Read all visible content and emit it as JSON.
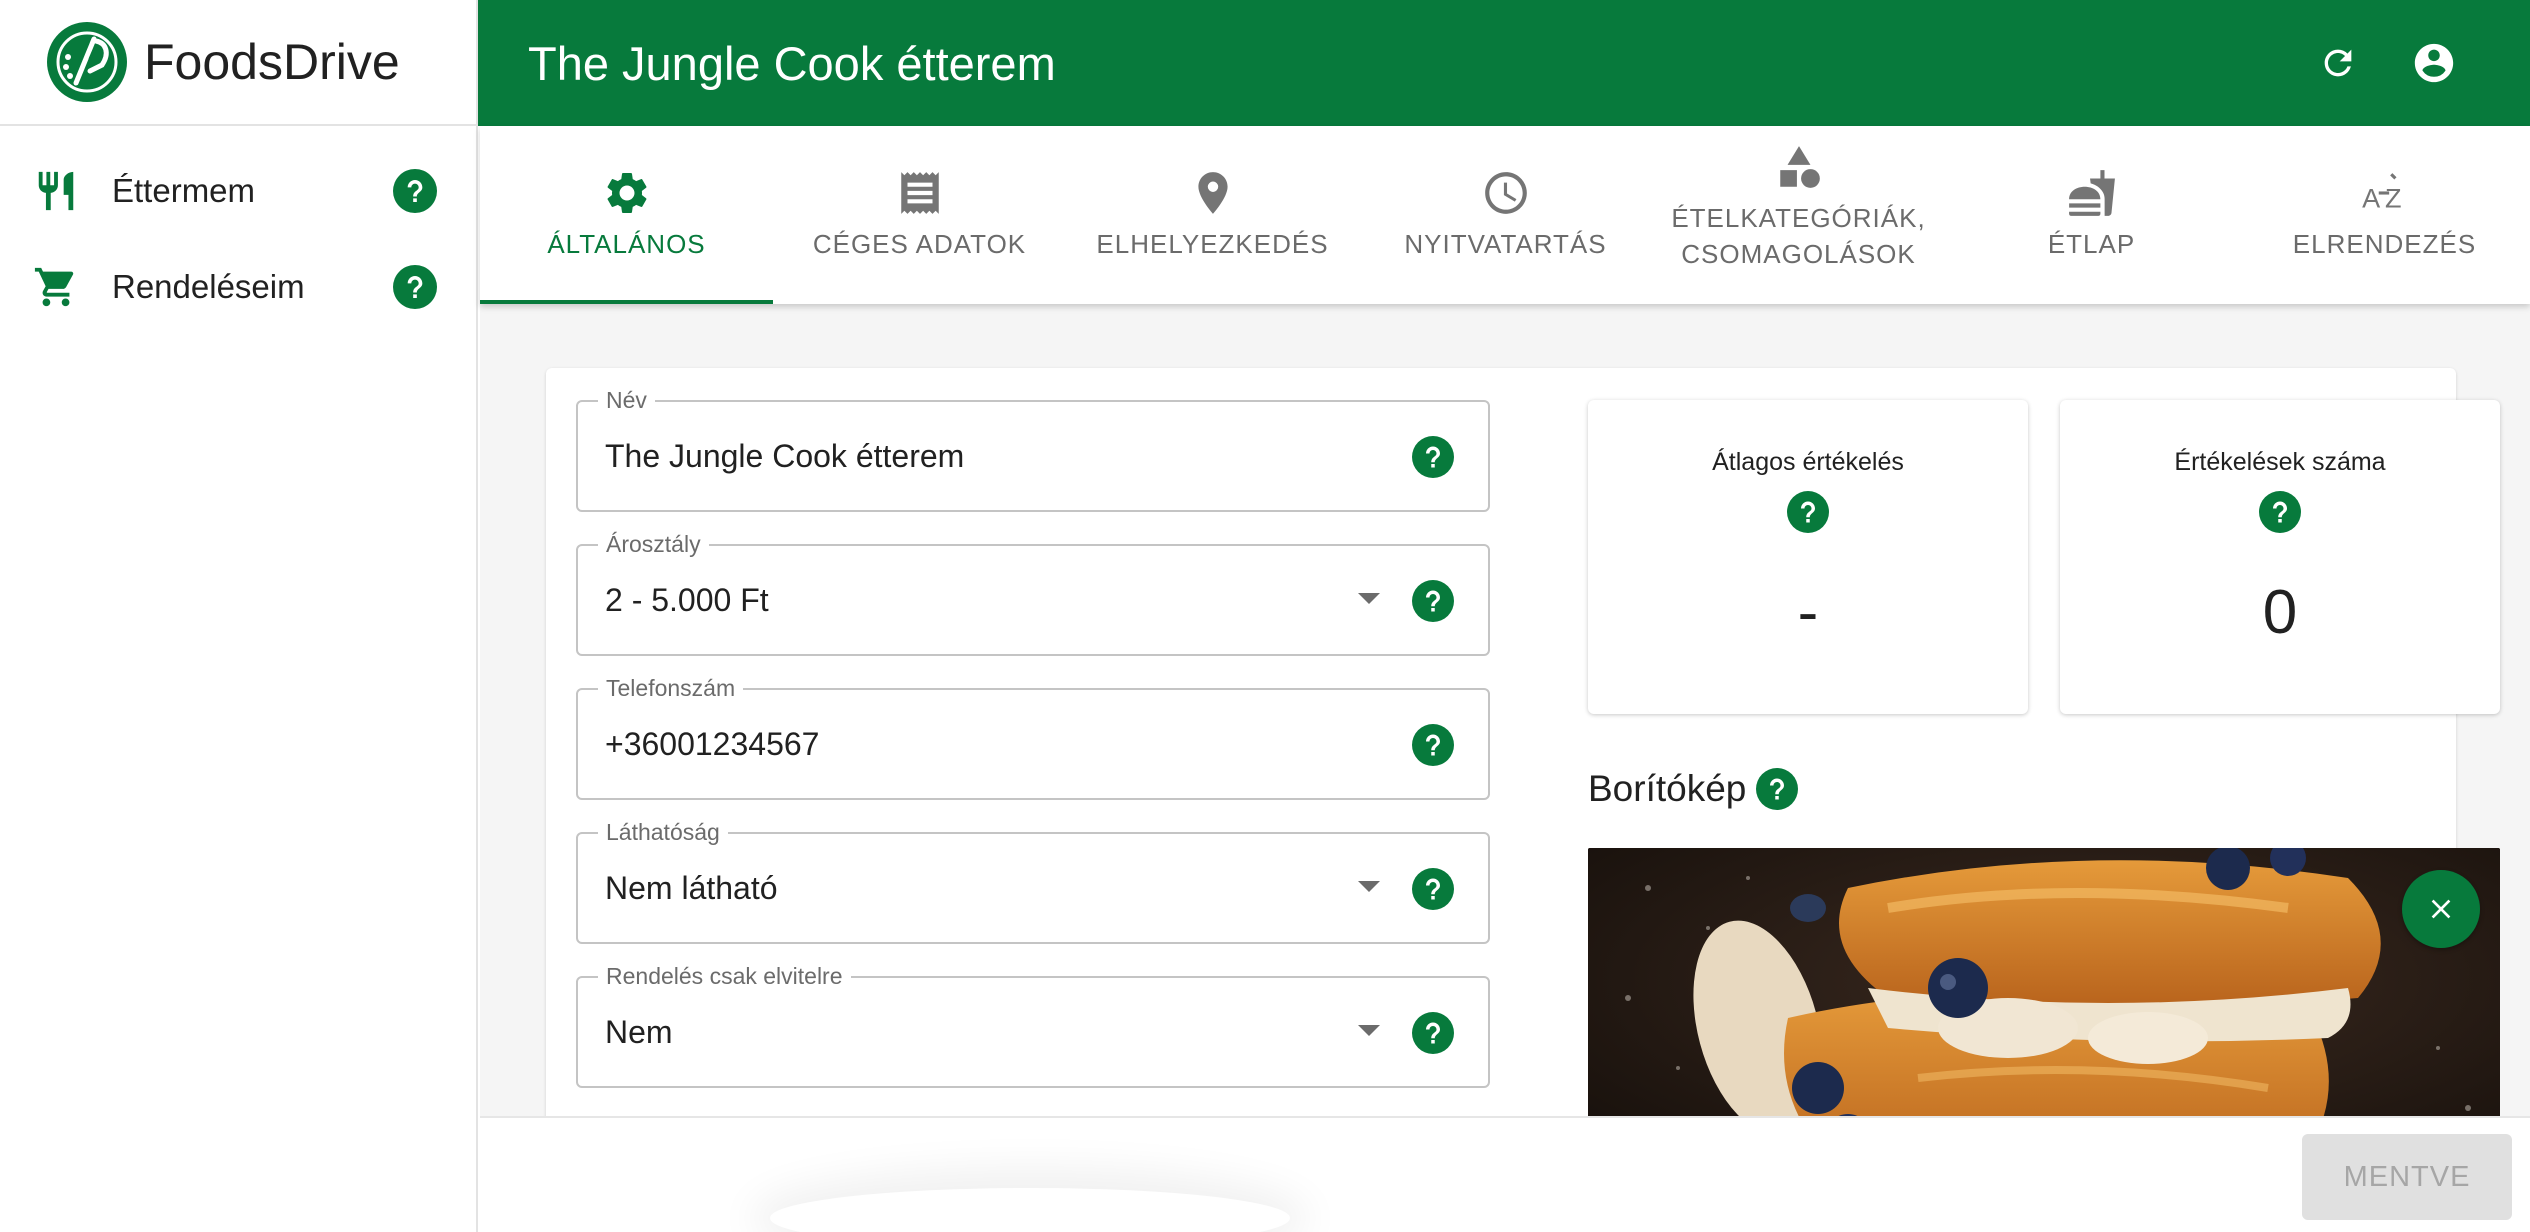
{
  "brand": {
    "name": "FoodsDrive"
  },
  "sidebar": {
    "items": [
      {
        "label": "Éttermem",
        "icon": "fork-knife-icon"
      },
      {
        "label": "Rendeléseim",
        "icon": "shopping-cart-icon"
      }
    ]
  },
  "header": {
    "title": "The Jungle Cook étterem"
  },
  "tabs": [
    {
      "label": "ÁLTALÁNOS",
      "icon": "gear-icon",
      "active": true
    },
    {
      "label": "CÉGES ADATOK",
      "icon": "receipt-icon"
    },
    {
      "label": "ELHELYEZKEDÉS",
      "icon": "location-pin-icon"
    },
    {
      "label": "NYITVATARTÁS",
      "icon": "clock-icon"
    },
    {
      "label": "ÉTELKATEGÓRIÁK, CSOMAGOLÁSOK",
      "icon": "shapes-icon"
    },
    {
      "label": "ÉTLAP",
      "icon": "food-menu-icon"
    },
    {
      "label": "ELRENDEZÉS",
      "icon": "sort-alpha-icon"
    }
  ],
  "form": {
    "name": {
      "label": "Név",
      "value": "The Jungle Cook étterem"
    },
    "price_class": {
      "label": "Árosztály",
      "value": "2 - 5.000 Ft"
    },
    "phone": {
      "label": "Telefonszám",
      "value": "+36001234567"
    },
    "visibility": {
      "label": "Láthatóság",
      "value": "Nem látható"
    },
    "takeaway_only": {
      "label": "Rendelés csak elvitelre",
      "value": "Nem"
    }
  },
  "stats": {
    "avg_rating": {
      "label": "Átlagos értékelés",
      "value": "-"
    },
    "rating_count": {
      "label": "Értékelések száma",
      "value": "0"
    }
  },
  "cover": {
    "title": "Borítókép"
  },
  "footer": {
    "save_label": "MENTVE"
  },
  "colors": {
    "accent": "#077a3c",
    "background": "#f5f5f5"
  }
}
